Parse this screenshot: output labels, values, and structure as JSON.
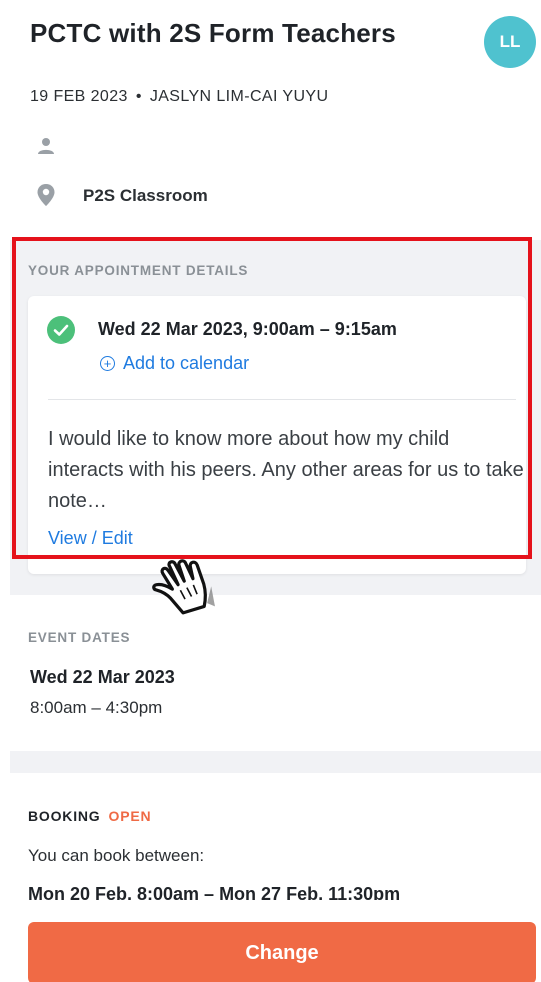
{
  "header": {
    "title": "PCTC with 2S Form Teachers",
    "avatar_initials": "LL",
    "date": "19 FEB 2023",
    "separator": "•",
    "teacher": "JASLYN LIM-CAI YUYU"
  },
  "details": {
    "location": "P2S Classroom"
  },
  "appointment": {
    "section_label": "YOUR APPOINTMENT DETAILS",
    "time": "Wed 22 Mar 2023, 9:00am – 9:15am",
    "add_calendar_label": "Add to calendar",
    "note": "I would like to know more about how my child interacts with his peers. Any other areas for us to take note…",
    "view_edit_label": "View / Edit"
  },
  "event_dates": {
    "section_label": "EVENT DATES",
    "date": "Wed 22 Mar 2023",
    "time": "8:00am – 4:30pm"
  },
  "booking": {
    "label": "BOOKING",
    "status": "OPEN",
    "between_text": "You can book between:",
    "range": "Mon 20 Feb, 8:00am – Mon 27 Feb, 11:30pm"
  },
  "actions": {
    "change_label": "Change"
  },
  "colors": {
    "accent_orange": "#f06a45",
    "link_blue": "#1f7be0",
    "check_green": "#4cc07a",
    "avatar_teal": "#4fc2cf",
    "highlight_red": "#e5121b"
  },
  "icons": {
    "person": "person-icon",
    "location": "location-pin-icon",
    "check": "check-circle-icon",
    "add_calendar": "plus-circle-icon",
    "pointer": "hand-pointer-icon"
  }
}
